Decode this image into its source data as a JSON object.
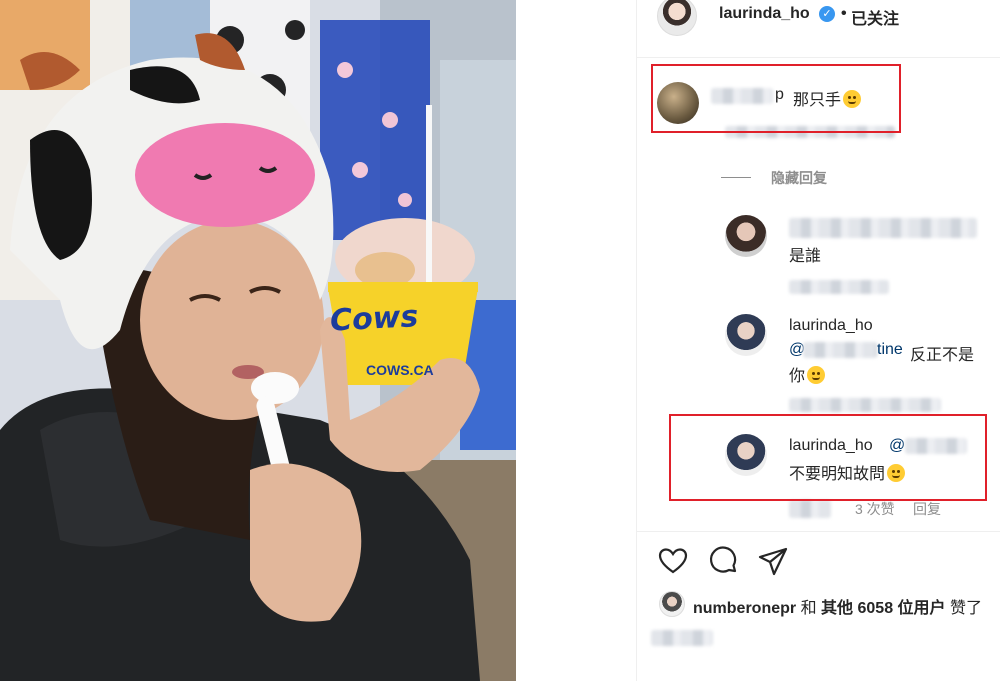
{
  "header": {
    "username": "laurinda_ho",
    "verified_icon": "verified-badge-icon",
    "separator": "•",
    "follow_label": "已关注"
  },
  "photo": {
    "cup_brand": "Cows",
    "cup_url": "COWS.CA"
  },
  "comments": [
    {
      "username_visible": "p",
      "text": "那只手"
    },
    {
      "hide_replies_label": "隐藏回复"
    },
    {
      "text": "是誰"
    },
    {
      "username": "laurinda_ho",
      "mention_visible": "@",
      "mention_tail": "tine",
      "text_line1": "反正不是",
      "text_line2": "你"
    },
    {
      "username": "laurinda_ho",
      "mention_visible": "@",
      "text": "不要明知故問",
      "likes": "3 次赞",
      "reply_label": "回复"
    }
  ],
  "actions": {
    "like_icon": "heart-icon",
    "comment_icon": "comment-icon",
    "share_icon": "paper-plane-icon"
  },
  "likes": {
    "liker": "numberonepr",
    "and_label": "和",
    "others_label": "其他 6058 位用户",
    "suffix": "赞了"
  },
  "colors": {
    "highlight_box": "#e0202a",
    "verified": "#3897f0",
    "mention": "#00376b"
  }
}
